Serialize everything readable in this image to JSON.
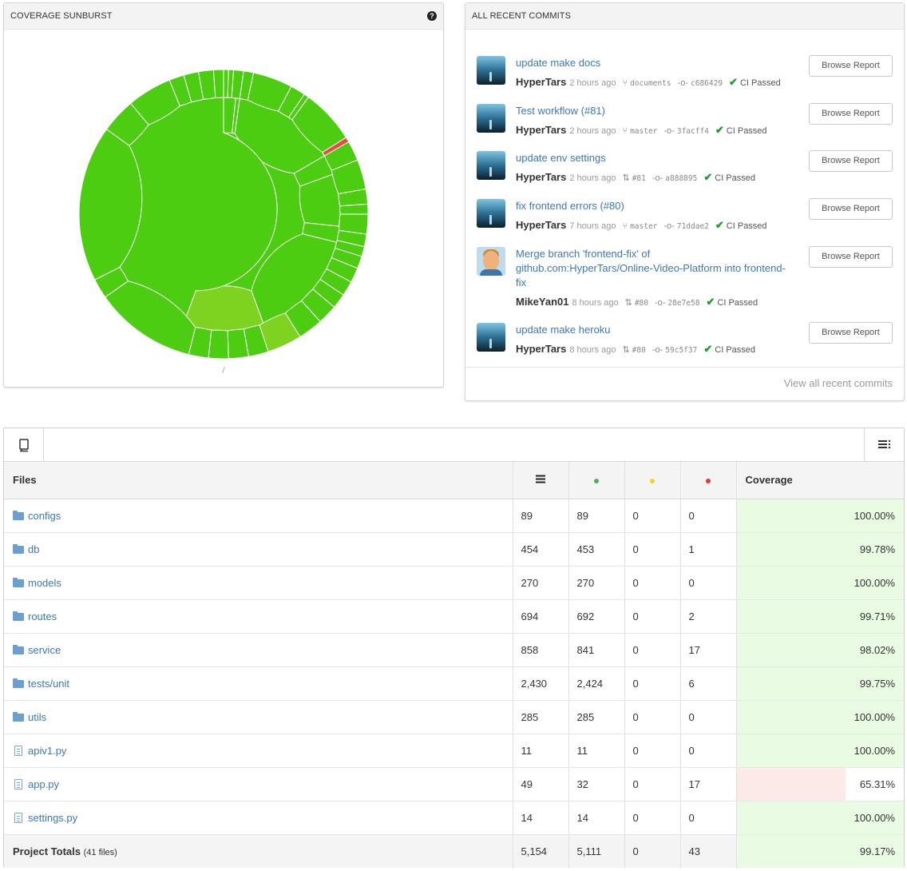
{
  "sunburst": {
    "title": "COVERAGE SUNBURST",
    "caption": "/",
    "colors": {
      "high": "#4ccd12",
      "mid": "#7ed321",
      "low": "#e74c3c",
      "separator": "#ffffff"
    }
  },
  "commits": {
    "title": "ALL RECENT COMMITS",
    "footer_link": "View all recent commits",
    "ci_label": "CI Passed",
    "items": [
      {
        "message": "update make docs",
        "author": "HyperTars",
        "time": "2 hours ago",
        "ref_icon": "branch-icon",
        "ref": "documents",
        "sha": "c686429",
        "button": "Browse Report"
      },
      {
        "message": "Test workflow (#81)",
        "author": "HyperTars",
        "time": "2 hours ago",
        "ref_icon": "branch-icon",
        "ref": "master",
        "sha": "3facff4",
        "button": "Browse Report"
      },
      {
        "message": "update env settings",
        "author": "HyperTars",
        "time": "2 hours ago",
        "ref_icon": "pull-request-icon",
        "ref": "#81",
        "sha": "a888895",
        "button": "Browse Report"
      },
      {
        "message": "fix frontend errors (#80)",
        "author": "HyperTars",
        "time": "7 hours ago",
        "ref_icon": "branch-icon",
        "ref": "master",
        "sha": "71ddae2",
        "button": "Browse Report"
      },
      {
        "message": "Merge branch 'frontend-fix' of github.com:HyperTars/Online-Video-Platform into frontend-fix",
        "author": "MikeYan01",
        "time": "8 hours ago",
        "ref_icon": "pull-request-icon",
        "ref": "#80",
        "sha": "28e7e58",
        "button": "Browse Report"
      },
      {
        "message": "update make heroku",
        "author": "HyperTars",
        "time": "8 hours ago",
        "ref_icon": "pull-request-icon",
        "ref": "#80",
        "sha": "59c5f37",
        "button": "Browse Report"
      }
    ]
  },
  "files": {
    "headers": {
      "name": "Files",
      "lines_icon": "lines-icon",
      "hit_color": "#4caf50",
      "partial_color": "#f4d321",
      "miss_color": "#e53935",
      "coverage": "Coverage"
    },
    "rows": [
      {
        "type": "folder",
        "name": "configs",
        "lines": "89",
        "hits": "89",
        "partials": "0",
        "misses": "0",
        "coverage": "100.00%",
        "pct": 100
      },
      {
        "type": "folder",
        "name": "db",
        "lines": "454",
        "hits": "453",
        "partials": "0",
        "misses": "1",
        "coverage": "99.78%",
        "pct": 99.78
      },
      {
        "type": "folder",
        "name": "models",
        "lines": "270",
        "hits": "270",
        "partials": "0",
        "misses": "0",
        "coverage": "100.00%",
        "pct": 100
      },
      {
        "type": "folder",
        "name": "routes",
        "lines": "694",
        "hits": "692",
        "partials": "0",
        "misses": "2",
        "coverage": "99.71%",
        "pct": 99.71
      },
      {
        "type": "folder",
        "name": "service",
        "lines": "858",
        "hits": "841",
        "partials": "0",
        "misses": "17",
        "coverage": "98.02%",
        "pct": 98.02
      },
      {
        "type": "folder",
        "name": "tests/unit",
        "lines": "2,430",
        "hits": "2,424",
        "partials": "0",
        "misses": "6",
        "coverage": "99.75%",
        "pct": 99.75
      },
      {
        "type": "folder",
        "name": "utils",
        "lines": "285",
        "hits": "285",
        "partials": "0",
        "misses": "0",
        "coverage": "100.00%",
        "pct": 100
      },
      {
        "type": "file",
        "name": "apiv1.py",
        "lines": "11",
        "hits": "11",
        "partials": "0",
        "misses": "0",
        "coverage": "100.00%",
        "pct": 100
      },
      {
        "type": "file",
        "name": "app.py",
        "lines": "49",
        "hits": "32",
        "partials": "0",
        "misses": "17",
        "coverage": "65.31%",
        "pct": 65.31
      },
      {
        "type": "file",
        "name": "settings.py",
        "lines": "14",
        "hits": "14",
        "partials": "0",
        "misses": "0",
        "coverage": "100.00%",
        "pct": 100
      }
    ],
    "totals": {
      "label": "Project Totals",
      "sub": "(41 files)",
      "lines": "5,154",
      "hits": "5,111",
      "partials": "0",
      "misses": "43",
      "coverage": "99.17%"
    }
  }
}
